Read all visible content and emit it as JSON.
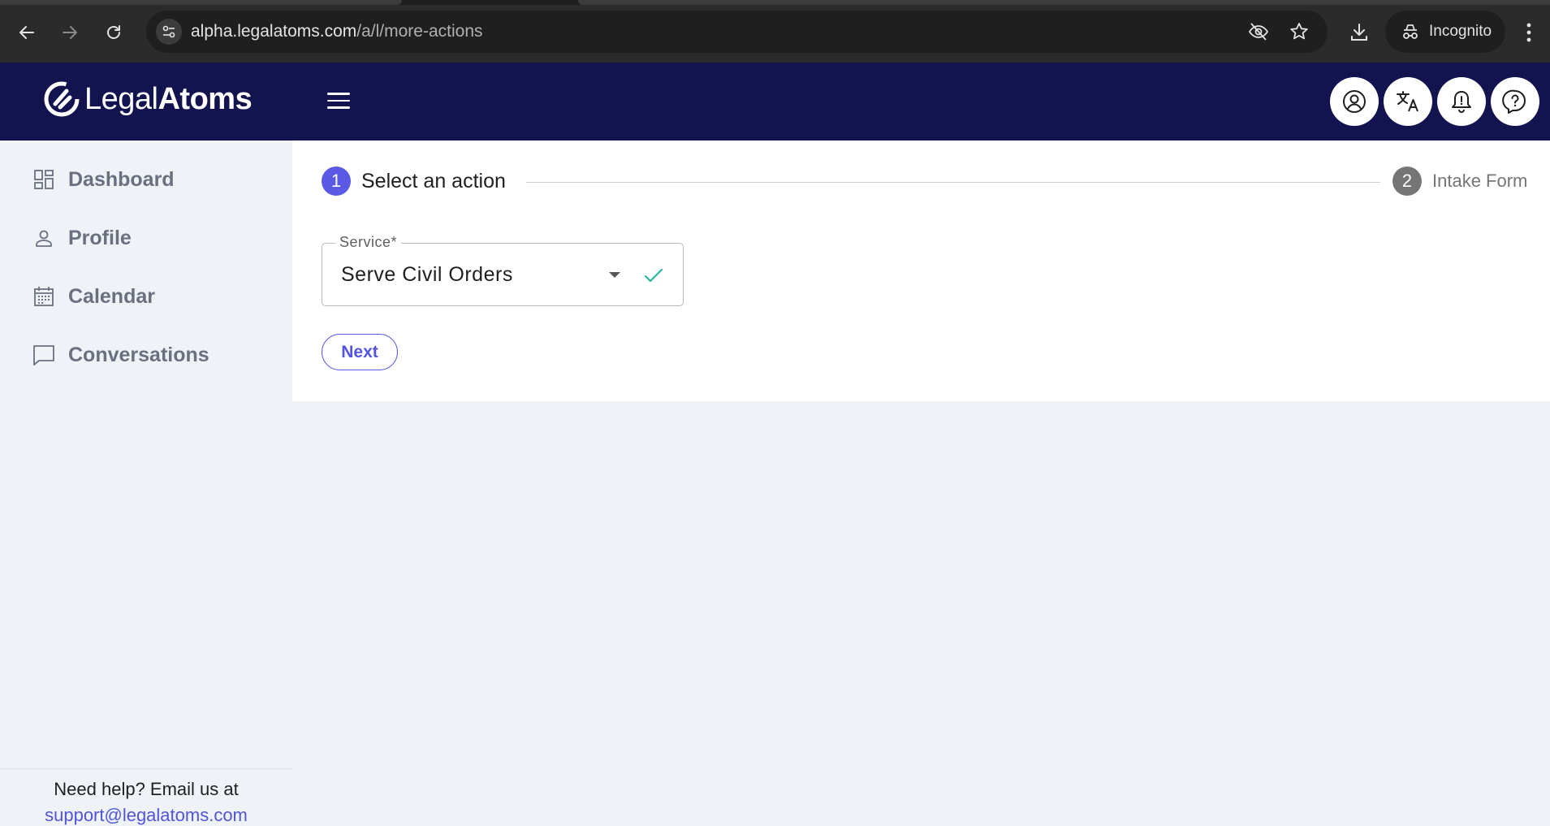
{
  "browser": {
    "url_host": "alpha.legalatoms.com",
    "url_path": "/a/l/more-actions",
    "incognito_label": "Incognito"
  },
  "app": {
    "logo_text_regular": "Legal",
    "logo_text_bold": "Atoms",
    "brand_color": "#13134f",
    "accent_color": "#5a5ae6"
  },
  "header": {
    "buttons": [
      "account-icon",
      "translate-icon",
      "bell-icon",
      "help-icon"
    ]
  },
  "sidebar": {
    "items": [
      {
        "label": "Dashboard",
        "icon": "dashboard-icon"
      },
      {
        "label": "Profile",
        "icon": "person-icon"
      },
      {
        "label": "Calendar",
        "icon": "calendar-icon"
      },
      {
        "label": "Conversations",
        "icon": "chat-icon"
      }
    ],
    "help_text": "Need help? Email us at",
    "help_email": "support@legalatoms.com"
  },
  "stepper": {
    "steps": [
      {
        "number": "1",
        "label": "Select an action",
        "active": true
      },
      {
        "number": "2",
        "label": "Intake Form",
        "active": false
      }
    ]
  },
  "form": {
    "service_label": "Service*",
    "service_value": "Serve Civil Orders",
    "next_label": "Next"
  }
}
